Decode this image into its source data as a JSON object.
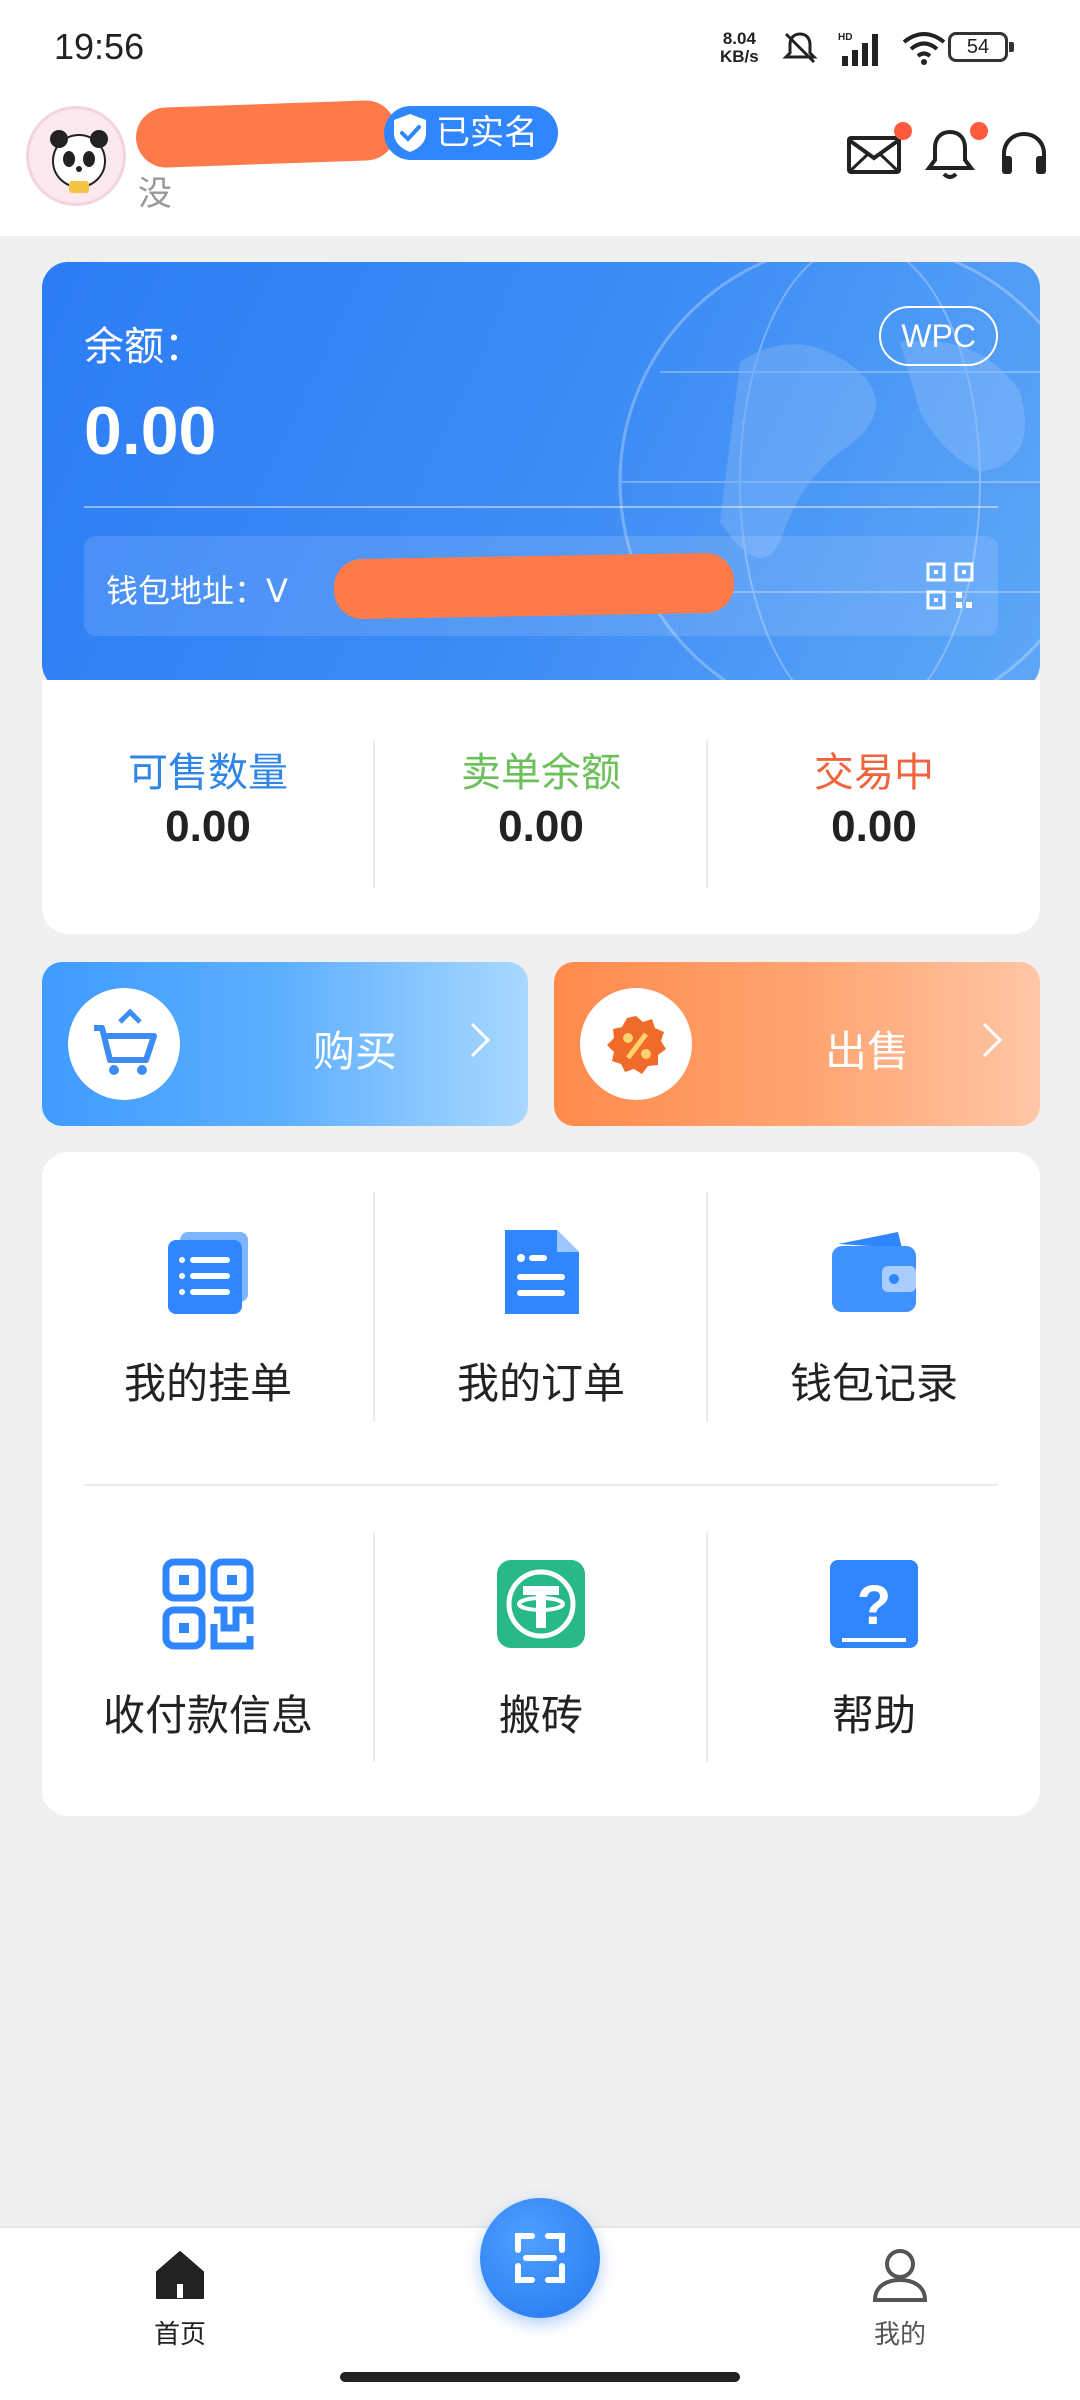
{
  "status_bar": {
    "time": "19:56",
    "net_speed_value": "8.04",
    "net_speed_unit": "KB/s",
    "battery": "54"
  },
  "header": {
    "verified_label": "已实名",
    "subname": "没"
  },
  "wallet": {
    "balance_label": "余额：",
    "balance_value": "0.00",
    "coin": "WPC",
    "address_label": "钱包地址：V"
  },
  "stats": [
    {
      "label": "可售数量",
      "value": "0.00",
      "color": "#2f86e6"
    },
    {
      "label": "卖单余额",
      "value": "0.00",
      "color": "#6cc05a"
    },
    {
      "label": "交易中",
      "value": "0.00",
      "color": "#f0643c"
    }
  ],
  "actions": {
    "buy_label": "购买",
    "sell_label": "出售"
  },
  "menu": [
    {
      "label": "我的挂单",
      "icon": "order-list-icon"
    },
    {
      "label": "我的订单",
      "icon": "document-icon"
    },
    {
      "label": "钱包记录",
      "icon": "wallet-icon"
    },
    {
      "label": "收付款信息",
      "icon": "qr-code-icon"
    },
    {
      "label": "搬砖",
      "icon": "tether-icon"
    },
    {
      "label": "帮助",
      "icon": "help-icon"
    }
  ],
  "bottom_nav": {
    "home_label": "首页",
    "mine_label": "我的"
  }
}
